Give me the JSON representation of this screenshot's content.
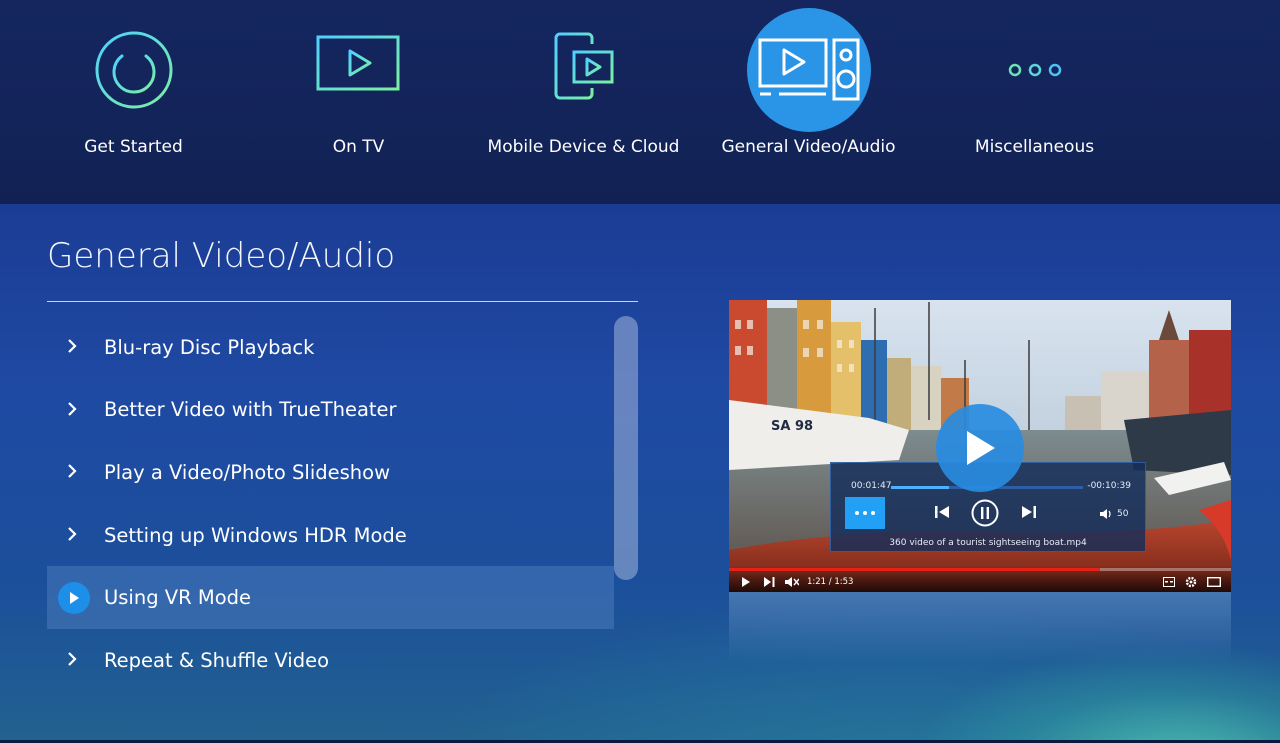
{
  "nav": {
    "items": [
      {
        "label": "Get Started",
        "icon": "power-icon"
      },
      {
        "label": "On TV",
        "icon": "tv-icon"
      },
      {
        "label": "Mobile Device & Cloud",
        "icon": "mobile-cloud-icon"
      },
      {
        "label": "General Video/Audio",
        "icon": "video-audio-icon",
        "active": true
      },
      {
        "label": "Miscellaneous",
        "icon": "more-dots-icon"
      }
    ]
  },
  "section": {
    "title": "General Video/Audio",
    "items": [
      {
        "label": "Blu-ray Disc Playback"
      },
      {
        "label": "Better Video with TrueTheater"
      },
      {
        "label": "Play a Video/Photo Slideshow"
      },
      {
        "label": "Setting up Windows HDR Mode"
      },
      {
        "label": "Using VR Mode",
        "active": true
      },
      {
        "label": "Repeat & Shuffle Video"
      }
    ]
  },
  "preview": {
    "elapsed": "00:01:47",
    "remaining": "-00:10:39",
    "seek_progress": 0.3,
    "volume": "50",
    "filename": "360 video of a tourist sightseeing boat.mp4",
    "yt_time": "1:21 / 1:53",
    "yt_progress": 0.74
  },
  "colors": {
    "accent": "#2a95e6",
    "icon_stroke": "#5fd8c3",
    "header_bg": "#13245a"
  }
}
